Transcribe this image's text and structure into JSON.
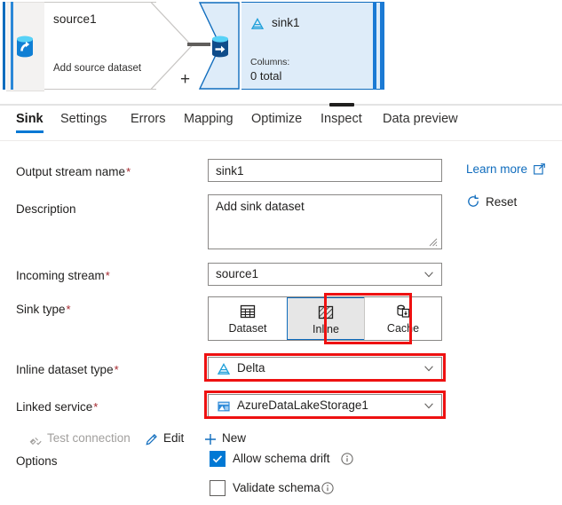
{
  "canvas": {
    "source_node": {
      "title": "source1",
      "subtitle": "Add source dataset",
      "icon": "source-database-icon"
    },
    "sink_node": {
      "title": "sink1",
      "columns_label": "Columns:",
      "columns_value": "0 total",
      "icon": "sink-database-icon",
      "type_icon": "delta-lake-icon"
    },
    "add_button": "+"
  },
  "tabs": [
    {
      "label": "Sink",
      "active": true
    },
    {
      "label": "Settings",
      "active": false
    },
    {
      "label": "Errors",
      "active": false
    },
    {
      "label": "Mapping",
      "active": false
    },
    {
      "label": "Optimize",
      "active": false
    },
    {
      "label": "Inspect",
      "active": false
    },
    {
      "label": "Data preview",
      "active": false
    }
  ],
  "form": {
    "output_stream": {
      "label": "Output stream name",
      "required_marker": "*",
      "value": "sink1",
      "placeholder": "Output stream name"
    },
    "description": {
      "label": "Description",
      "value": "Add sink dataset",
      "placeholder": "Add sink dataset"
    },
    "incoming_stream": {
      "label": "Incoming stream",
      "required_marker": "*",
      "value": "source1"
    },
    "sink_type": {
      "label": "Sink type",
      "required_marker": "*",
      "selected": "Inline",
      "options": [
        {
          "label": "Dataset",
          "icon": "table-grid-icon",
          "selected": false
        },
        {
          "label": "Inline",
          "icon": "diagonal-hatch-icon",
          "selected": true
        },
        {
          "label": "Cache",
          "icon": "cache-database-icon",
          "selected": false
        }
      ]
    },
    "inline_dataset_type": {
      "label": "Inline dataset type",
      "required_marker": "*",
      "value": "Delta",
      "icon": "delta-lake-icon"
    },
    "linked_service": {
      "label": "Linked service",
      "required_marker": "*",
      "value": "AzureDataLakeStorage1",
      "icon": "azure-storage-icon"
    },
    "options": {
      "label": "Options",
      "items": [
        {
          "label": "Allow schema drift",
          "checked": true,
          "info": "info-icon"
        },
        {
          "label": "Validate schema",
          "checked": false,
          "info": "info-icon"
        }
      ]
    }
  },
  "side_actions": {
    "learn_more": "Learn more",
    "learn_more_icon": "external-link-icon",
    "reset": "Reset",
    "reset_icon": "refresh-circle-icon"
  },
  "connection_actions": [
    {
      "label": "Test connection",
      "icon": "plug-check-icon",
      "enabled": false
    },
    {
      "label": "Edit",
      "icon": "pencil-icon",
      "enabled": true
    },
    {
      "label": "New",
      "icon": "plus-icon",
      "enabled": true
    }
  ],
  "colors": {
    "accent": "#0078d4",
    "link": "#0f6cbd",
    "required": "#a4262c",
    "highlight": "#ee1111",
    "sink_fill": "#deecf9"
  }
}
